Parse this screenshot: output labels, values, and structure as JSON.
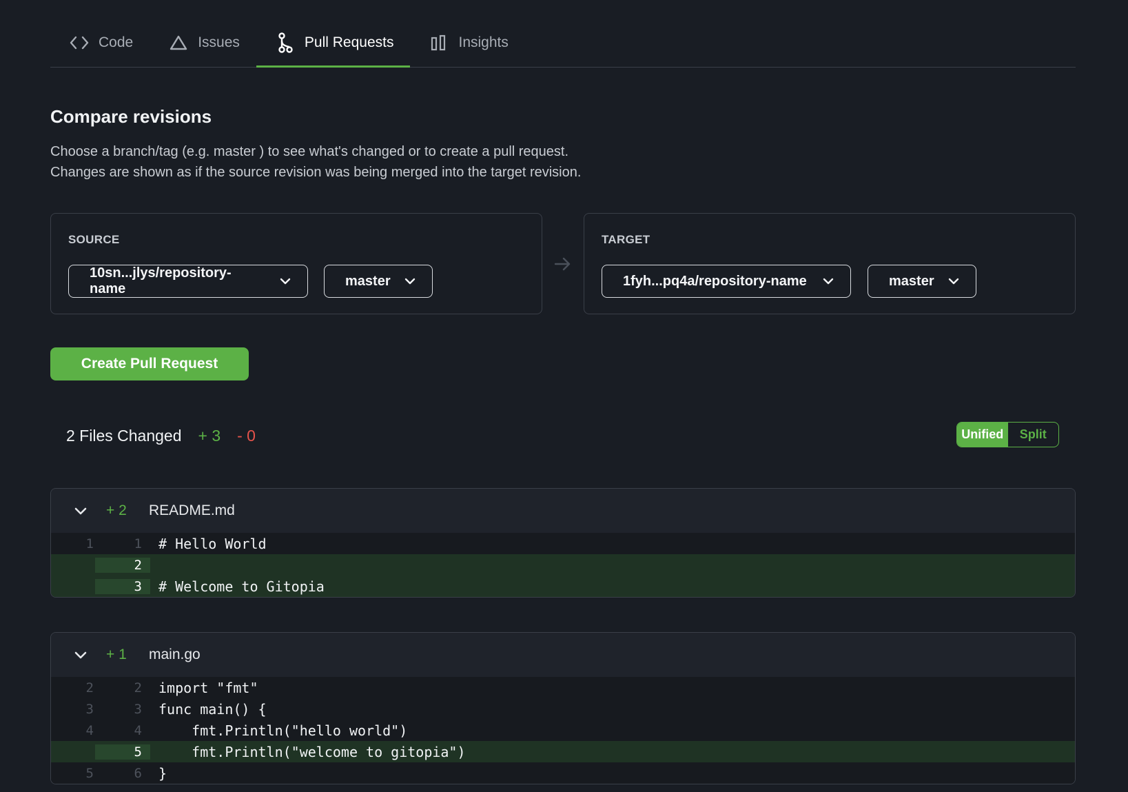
{
  "tabs": [
    {
      "label": "Code",
      "icon": "code-icon"
    },
    {
      "label": "Issues",
      "icon": "issues-icon"
    },
    {
      "label": "Pull Requests",
      "icon": "pull-request-icon",
      "active": true
    },
    {
      "label": "Insights",
      "icon": "insights-icon"
    }
  ],
  "compare": {
    "title": "Compare revisions",
    "desc_line1": "Choose a branch/tag (e.g. master ) to see what's changed or to create a pull request.",
    "desc_line2": "Changes are shown as if the source revision was being merged into the target revision."
  },
  "source": {
    "label": "SOURCE",
    "repo": "10sn...jlys/repository-name",
    "branch": "master"
  },
  "target": {
    "label": "TARGET",
    "repo": "1fyh...pq4a/repository-name",
    "branch": "master"
  },
  "create_button": "Create Pull Request",
  "summary": {
    "files_changed": "2 Files Changed",
    "additions": "+ 3",
    "deletions": "- 0"
  },
  "view_toggle": {
    "unified": "Unified",
    "split": "Split",
    "selected": "Unified"
  },
  "colors": {
    "accent": "#5cb146",
    "deletion": "#e5534b",
    "background": "#191d24"
  },
  "files": [
    {
      "name": "README.md",
      "additions": "+ 2",
      "lines": [
        {
          "old": "1",
          "new": "1",
          "code": "# Hello World",
          "added": false
        },
        {
          "old": "",
          "new": "2",
          "code": "",
          "added": true
        },
        {
          "old": "",
          "new": "3",
          "code": "# Welcome to Gitopia",
          "added": true
        }
      ]
    },
    {
      "name": "main.go",
      "additions": "+ 1",
      "lines": [
        {
          "old": "2",
          "new": "2",
          "code": "import \"fmt\"",
          "added": false
        },
        {
          "old": "3",
          "new": "3",
          "code": "func main() {",
          "added": false
        },
        {
          "old": "4",
          "new": "4",
          "code": "    fmt.Println(\"hello world\")",
          "added": false
        },
        {
          "old": "",
          "new": "5",
          "code": "    fmt.Println(\"welcome to gitopia\")",
          "added": true
        },
        {
          "old": "5",
          "new": "6",
          "code": "}",
          "added": false
        }
      ]
    }
  ]
}
